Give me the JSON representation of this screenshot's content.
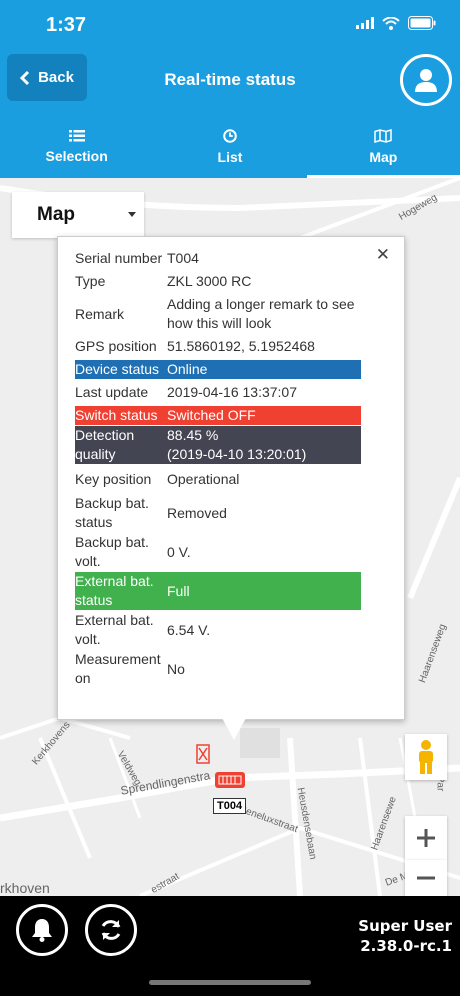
{
  "status_bar": {
    "time": "1:37"
  },
  "header": {
    "back_label": "Back",
    "title": "Real-time status",
    "tabs": [
      {
        "label": "Selection",
        "icon": "list-icon"
      },
      {
        "label": "List",
        "icon": "clock-icon"
      },
      {
        "label": "Map",
        "icon": "map-icon"
      }
    ],
    "active_tab": "Map"
  },
  "map": {
    "view_select": "Map",
    "street_labels": [
      "Hogeweg",
      "Haarenseweg",
      "Kerkhovens",
      "Veldweg",
      "Sprendlingenstra",
      "Heusdensebaan",
      "Beneluxstraat",
      "Haarensewe",
      "De M",
      "Par",
      "rkhoven",
      "estraat"
    ],
    "marker_label": "T004",
    "colors": {
      "online": "#1f6fb4",
      "switched_off": "#ef4031",
      "detection": "#444553",
      "battery_full": "#40b14d"
    }
  },
  "popup": {
    "rows": [
      {
        "key": "Serial number",
        "value": "T004"
      },
      {
        "key": "Type",
        "value": "ZKL 3000 RC"
      },
      {
        "key": "Remark",
        "value": "Adding a longer remark to see how this will look"
      },
      {
        "key": "GPS position",
        "value": "51.5860192, 5.1952468"
      },
      {
        "key": "Device status",
        "value": "Online"
      },
      {
        "key": "Last update",
        "value": "2019-04-16 13:37:07"
      },
      {
        "key": "Switch status",
        "value": "Switched OFF"
      },
      {
        "key": "Detection quality",
        "value": "88.45 %",
        "value2": "(2019-04-10 13:20:01)"
      },
      {
        "key": "Key position",
        "value": "Operational"
      },
      {
        "key": "Backup bat. status",
        "value": "Removed"
      },
      {
        "key": "Backup bat. volt.",
        "value": "0 V."
      },
      {
        "key": "External bat. status",
        "value": "Full"
      },
      {
        "key": "External bat. volt.",
        "value": "6.54 V."
      },
      {
        "key": "Measurement on",
        "value": "No"
      }
    ]
  },
  "footer": {
    "user_name": "Super User",
    "version": "2.38.0-rc.1"
  }
}
